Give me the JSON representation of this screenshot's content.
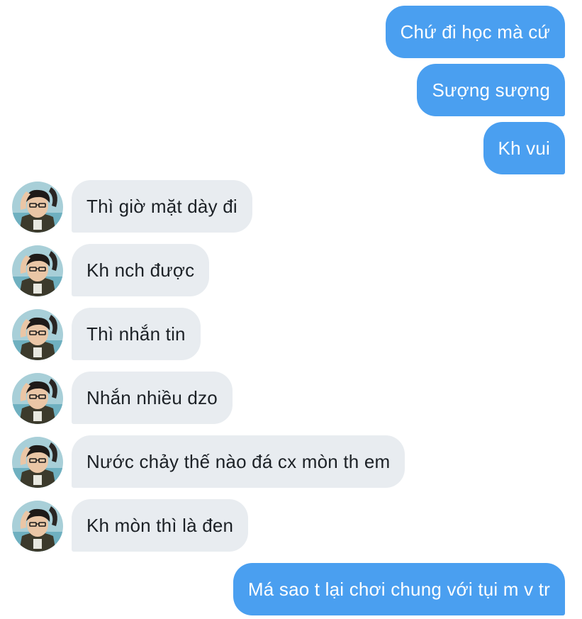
{
  "messages": [
    {
      "from": "me",
      "text": "Chứ đi học mà cứ"
    },
    {
      "from": "me",
      "text": "Sượng sượng"
    },
    {
      "from": "me",
      "text": "Kh vui"
    },
    {
      "from": "friend",
      "text": "Thì giờ mặt dày đi"
    },
    {
      "from": "friend",
      "text": "Kh nch được"
    },
    {
      "from": "friend",
      "text": "Thì nhắn tin"
    },
    {
      "from": "friend",
      "text": "Nhắn nhiều dzo"
    },
    {
      "from": "friend",
      "text": "Nước chảy thế nào đá cx mòn th em"
    },
    {
      "from": "friend",
      "text": "Kh mòn thì là đen"
    },
    {
      "from": "me",
      "text": "Má sao t lại chơi chung với tụi m v tr"
    }
  ],
  "friend_avatar_icon": "person-photo-avatar",
  "colors": {
    "outgoing_bubble": "#4a9ff0",
    "incoming_bubble": "#e8ecf0",
    "incoming_text": "#1c2126",
    "outgoing_text": "#ffffff"
  }
}
